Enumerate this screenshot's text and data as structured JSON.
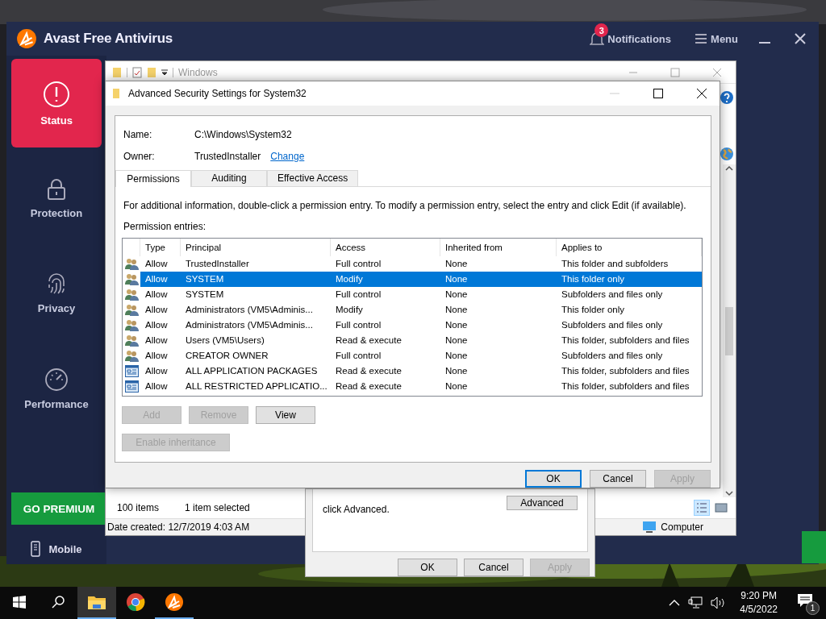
{
  "avast": {
    "title": "Avast Free Antivirus",
    "notifications": {
      "count": "3",
      "label": "Notifications"
    },
    "menu": "Menu",
    "nav": [
      {
        "kind": "status",
        "label": "Status",
        "selected": true
      },
      {
        "kind": "protection",
        "label": "Protection",
        "selected": false
      },
      {
        "kind": "privacy",
        "label": "Privacy",
        "selected": false
      },
      {
        "kind": "performance",
        "label": "Performance",
        "selected": false
      }
    ],
    "premium_button": "GO PREMIUM",
    "mobile": "Mobile"
  },
  "explorer": {
    "title": "Windows",
    "item_count": "100 items",
    "selection": "1 item selected",
    "details": "Date created: 12/7/2019 4:03 AM",
    "location": "Computer"
  },
  "properties_dialog": {
    "note": "click Advanced.",
    "advanced_button": "Advanced",
    "buttons": [
      {
        "label": "OK",
        "disabled": false
      },
      {
        "label": "Cancel",
        "disabled": false
      },
      {
        "label": "Apply",
        "disabled": true
      }
    ]
  },
  "security_dialog": {
    "title": "Advanced Security Settings for System32",
    "name_label": "Name:",
    "name": "C:\\Windows\\System32",
    "owner_label": "Owner:",
    "owner": "TrustedInstaller",
    "change_link": "Change",
    "tabs": [
      {
        "label": "Permissions",
        "selected": true
      },
      {
        "label": "Auditing",
        "selected": false
      },
      {
        "label": "Effective Access",
        "selected": false
      }
    ],
    "info": "For additional information, double-click a permission entry. To modify a permission entry, select the entry and click Edit (if available).",
    "entries_label": "Permission entries:",
    "table": {
      "columns": [
        "Type",
        "Principal",
        "Access",
        "Inherited from",
        "Applies to"
      ],
      "rows": [
        {
          "kind": "group",
          "selected": false,
          "cells": [
            "Allow",
            "TrustedInstaller",
            "Full control",
            "None",
            "This folder and subfolders"
          ]
        },
        {
          "kind": "group",
          "selected": true,
          "cells": [
            "Allow",
            "SYSTEM",
            "Modify",
            "None",
            "This folder only"
          ]
        },
        {
          "kind": "group",
          "selected": false,
          "cells": [
            "Allow",
            "SYSTEM",
            "Full control",
            "None",
            "Subfolders and files only"
          ]
        },
        {
          "kind": "group",
          "selected": false,
          "cells": [
            "Allow",
            "Administrators (VM5\\Adminis...",
            "Modify",
            "None",
            "This folder only"
          ]
        },
        {
          "kind": "group",
          "selected": false,
          "cells": [
            "Allow",
            "Administrators (VM5\\Adminis...",
            "Full control",
            "None",
            "Subfolders and files only"
          ]
        },
        {
          "kind": "group",
          "selected": false,
          "cells": [
            "Allow",
            "Users (VM5\\Users)",
            "Read & execute",
            "None",
            "This folder, subfolders and files"
          ]
        },
        {
          "kind": "group",
          "selected": false,
          "cells": [
            "Allow",
            "CREATOR OWNER",
            "Full control",
            "None",
            "Subfolders and files only"
          ]
        },
        {
          "kind": "package",
          "selected": false,
          "cells": [
            "Allow",
            "ALL APPLICATION PACKAGES",
            "Read & execute",
            "None",
            "This folder, subfolders and files"
          ]
        },
        {
          "kind": "package",
          "selected": false,
          "cells": [
            "Allow",
            "ALL RESTRICTED APPLICATIO...",
            "Read & execute",
            "None",
            "This folder, subfolders and files"
          ]
        }
      ]
    },
    "entry_buttons": [
      {
        "label": "Add",
        "disabled": true
      },
      {
        "label": "Remove",
        "disabled": true
      },
      {
        "label": "View",
        "disabled": false
      }
    ],
    "inheritance_button": {
      "label": "Enable inheritance",
      "disabled": true
    },
    "buttons": [
      {
        "label": "OK",
        "disabled": false,
        "default": true
      },
      {
        "label": "Cancel",
        "disabled": false,
        "default": false
      },
      {
        "label": "Apply",
        "disabled": true,
        "default": false
      }
    ]
  },
  "taskbar": {
    "apps": [
      {
        "kind": "explorer",
        "active": true,
        "running": true
      },
      {
        "kind": "chrome",
        "active": false,
        "running": false
      },
      {
        "kind": "avast",
        "active": false,
        "running": true
      }
    ],
    "time": "9:20 PM",
    "date": "4/5/2022",
    "notification_count": "1"
  }
}
